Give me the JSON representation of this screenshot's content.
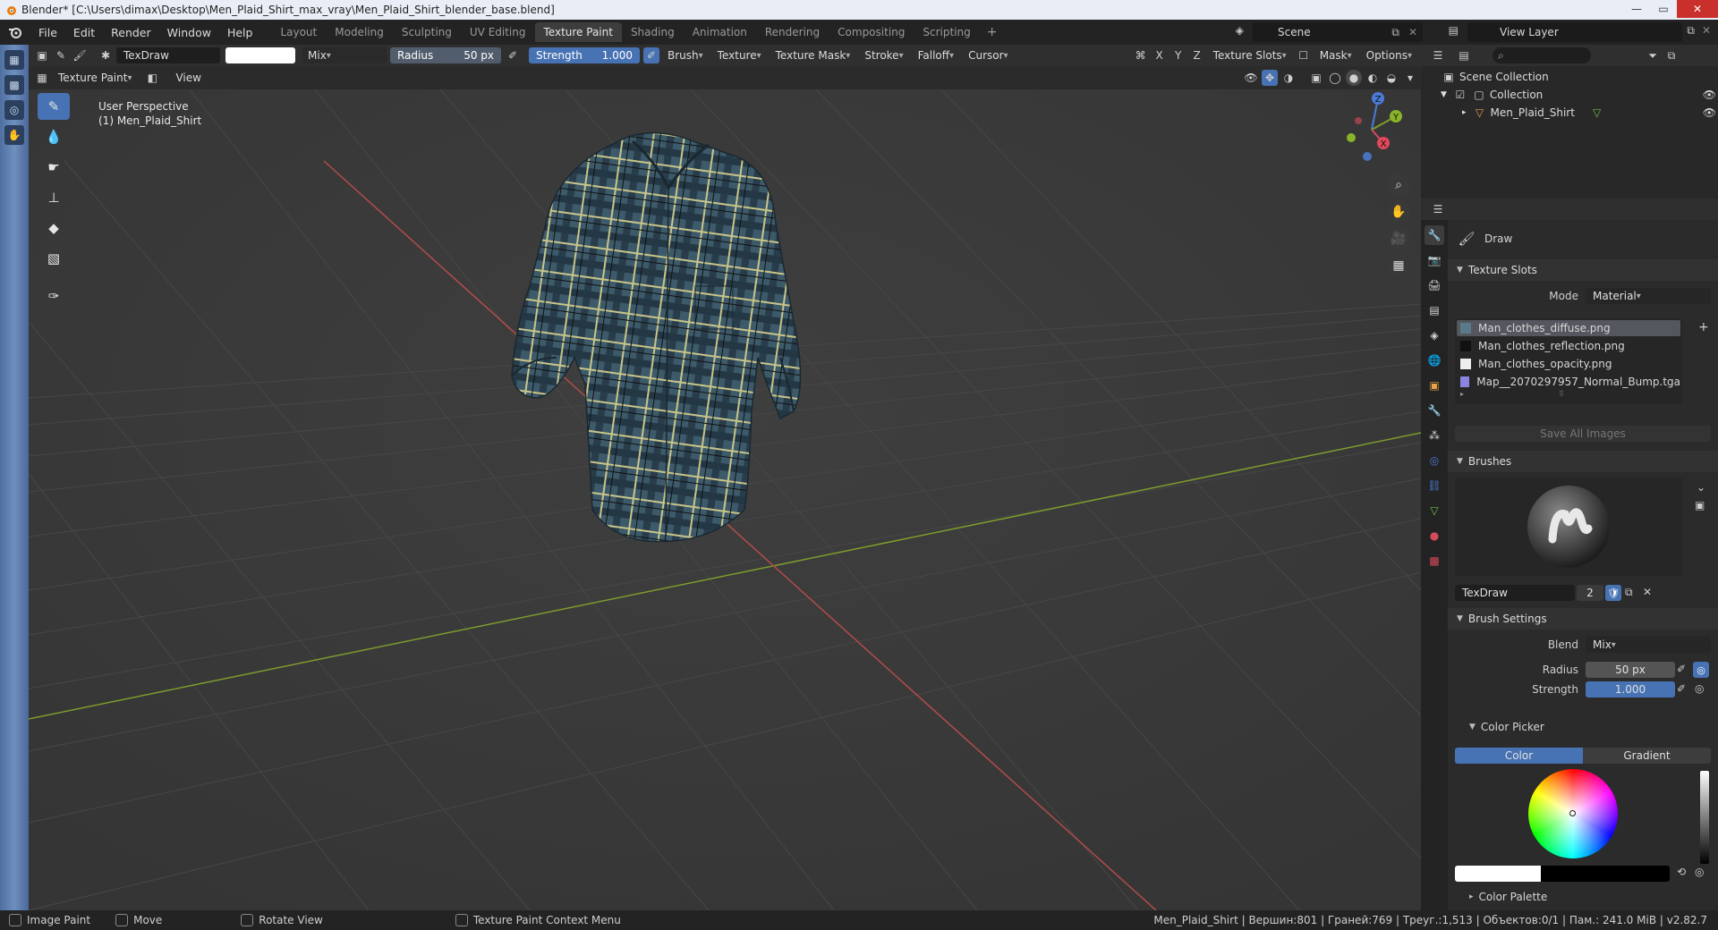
{
  "window": {
    "title": "Blender* [C:\\Users\\dimax\\Desktop\\Men_Plaid_Shirt_max_vray\\Men_Plaid_Shirt_blender_base.blend]",
    "controls": [
      "—",
      "▭",
      "✕"
    ]
  },
  "menu": [
    "File",
    "Edit",
    "Render",
    "Window",
    "Help"
  ],
  "workspaces": [
    {
      "label": "Layout",
      "active": false
    },
    {
      "label": "Modeling",
      "active": false
    },
    {
      "label": "Sculpting",
      "active": false
    },
    {
      "label": "UV Editing",
      "active": false
    },
    {
      "label": "Texture Paint",
      "active": true
    },
    {
      "label": "Shading",
      "active": false
    },
    {
      "label": "Animation",
      "active": false
    },
    {
      "label": "Rendering",
      "active": false
    },
    {
      "label": "Compositing",
      "active": false
    },
    {
      "label": "Scripting",
      "active": false
    }
  ],
  "workspace_add": "+",
  "scene": {
    "label": "Scene"
  },
  "view_layer": {
    "label": "View Layer"
  },
  "tool_header": {
    "brush_name": "TexDraw",
    "blend": "Mix",
    "radius_label": "Radius",
    "radius_value": "50 px",
    "strength_label": "Strength",
    "strength_value": "1.000",
    "menus": [
      "Brush",
      "Texture",
      "Texture Mask",
      "Stroke",
      "Falloff",
      "Cursor"
    ],
    "axes": [
      "X",
      "Y",
      "Z"
    ],
    "texture_slots": "Texture Slots",
    "mask": "Mask",
    "options": "Options"
  },
  "viewport_header": {
    "mode": "Texture Paint",
    "view": "View"
  },
  "viewport": {
    "perspective": "User Perspective",
    "object": "(1) Men_Plaid_Shirt",
    "gizmo": {
      "x": "X",
      "y": "Y",
      "z": "Z"
    }
  },
  "outliner": {
    "scene_collection": "Scene Collection",
    "collection": "Collection",
    "object": "Men_Plaid_Shirt"
  },
  "properties": {
    "tool_name": "Draw",
    "texture_slots": {
      "title": "Texture Slots",
      "mode_label": "Mode",
      "mode_value": "Material",
      "slots": [
        {
          "name": "Man_clothes_diffuse.png",
          "selected": true
        },
        {
          "name": "Man_clothes_reflection.png",
          "selected": false
        },
        {
          "name": "Man_clothes_opacity.png",
          "selected": false
        },
        {
          "name": "Map__2070297957_Normal_Bump.tga",
          "selected": false
        }
      ],
      "save_all": "Save All Images"
    },
    "brushes": {
      "title": "Brushes",
      "brush_name": "TexDraw",
      "users": "2"
    },
    "brush_settings": {
      "title": "Brush Settings",
      "blend_label": "Blend",
      "blend_value": "Mix",
      "radius_label": "Radius",
      "radius_value": "50 px",
      "strength_label": "Strength",
      "strength_value": "1.000"
    },
    "color_picker": {
      "title": "Color Picker",
      "tab_color": "Color",
      "tab_gradient": "Gradient"
    },
    "color_palette": {
      "title": "Color Palette"
    }
  },
  "statusbar": {
    "items": [
      "Image Paint",
      "Move",
      "Rotate View",
      "Texture Paint Context Menu"
    ],
    "stats": "Men_Plaid_Shirt | Вершин:801 | Граней:769 | Треуг.:1,513 | Объектов:0/1 | Пам.: 241.0 MiB | v2.82.7"
  },
  "colors": {
    "accent": "#4772b3",
    "viewport_bg": "#3a3a3a",
    "x_axis": "#b34b4b",
    "y_axis": "#7e9c2c",
    "shirt_base": "#3c5a6a",
    "plaid_yellow": "#c9c58a"
  },
  "icons": {
    "blender_logo": "blender-logo-icon",
    "draw": "brush-icon",
    "eye": "eye-icon"
  }
}
